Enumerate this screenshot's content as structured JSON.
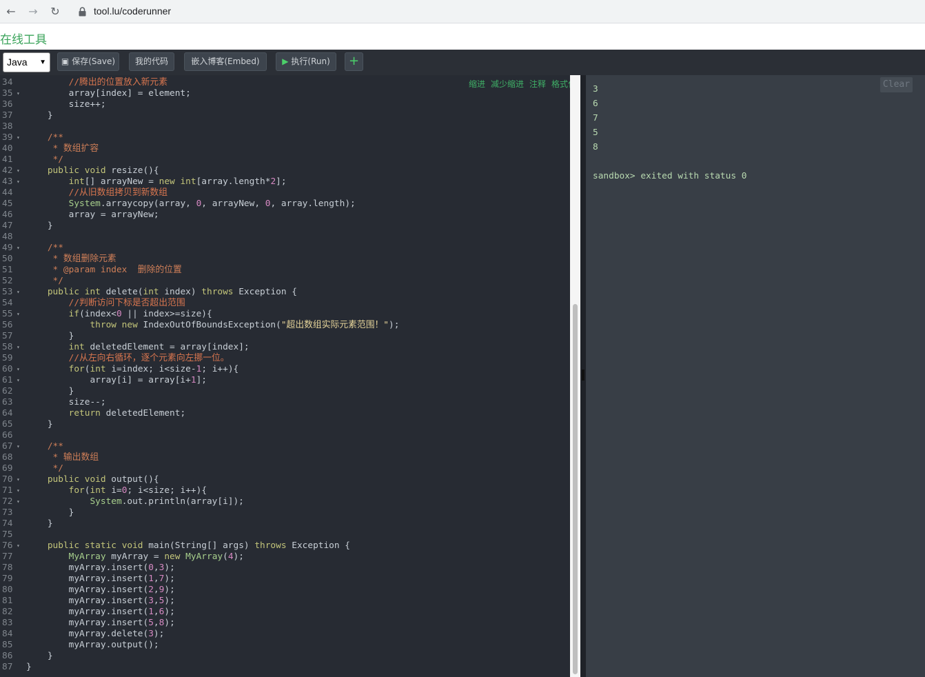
{
  "browser": {
    "back_icon": "arrow-left-icon",
    "forward_icon": "arrow-right-icon",
    "reload_icon": "reload-icon",
    "url": "tool.lu/coderunner"
  },
  "site": {
    "title": "在线工具"
  },
  "toolbar": {
    "language": "Java",
    "save_label": "保存(Save)",
    "mycode_label": "我的代码",
    "embed_label": "嵌入博客(Embed)",
    "run_label": "执行(Run)",
    "add_label": "+"
  },
  "editor": {
    "actions": [
      "缩进",
      "减少缩进",
      "注释",
      "格式化"
    ],
    "lines": [
      {
        "n": "34",
        "fold": "",
        "code": [
          [
            "        ",
            "id"
          ],
          [
            "//腾出的位置放入新元素",
            "cm"
          ]
        ]
      },
      {
        "n": "35",
        "fold": "▾",
        "code": [
          [
            "        array[index] = element;",
            "id"
          ]
        ]
      },
      {
        "n": "36",
        "fold": "",
        "code": [
          [
            "        size++;",
            "id"
          ]
        ]
      },
      {
        "n": "37",
        "fold": "",
        "code": [
          [
            "    }",
            "id"
          ]
        ]
      },
      {
        "n": "38",
        "fold": "",
        "code": []
      },
      {
        "n": "39",
        "fold": "▾",
        "code": [
          [
            "    /**",
            "doc"
          ]
        ]
      },
      {
        "n": "40",
        "fold": "",
        "code": [
          [
            "     * 数组扩容",
            "doc"
          ]
        ]
      },
      {
        "n": "41",
        "fold": "",
        "code": [
          [
            "     */",
            "doc"
          ]
        ]
      },
      {
        "n": "42",
        "fold": "▾",
        "code": [
          [
            "    ",
            "id"
          ],
          [
            "public void",
            "kw"
          ],
          [
            " resize(){",
            "id"
          ]
        ]
      },
      {
        "n": "43",
        "fold": "▾",
        "code": [
          [
            "        ",
            "id"
          ],
          [
            "int",
            "kw"
          ],
          [
            "[] arrayNew = ",
            "id"
          ],
          [
            "new int",
            "kw"
          ],
          [
            "[array.length*",
            "id"
          ],
          [
            "2",
            "num"
          ],
          [
            "];",
            "id"
          ]
        ]
      },
      {
        "n": "44",
        "fold": "",
        "code": [
          [
            "        ",
            "id"
          ],
          [
            "//从旧数组拷贝到新数组",
            "cm"
          ]
        ]
      },
      {
        "n": "45",
        "fold": "",
        "code": [
          [
            "        ",
            "id"
          ],
          [
            "System",
            "fn"
          ],
          [
            ".arraycopy(array, ",
            "id"
          ],
          [
            "0",
            "num"
          ],
          [
            ", arrayNew, ",
            "id"
          ],
          [
            "0",
            "num"
          ],
          [
            ", array.length);",
            "id"
          ]
        ]
      },
      {
        "n": "46",
        "fold": "",
        "code": [
          [
            "        array = arrayNew;",
            "id"
          ]
        ]
      },
      {
        "n": "47",
        "fold": "",
        "code": [
          [
            "    }",
            "id"
          ]
        ]
      },
      {
        "n": "48",
        "fold": "",
        "code": []
      },
      {
        "n": "49",
        "fold": "▾",
        "code": [
          [
            "    /**",
            "doc"
          ]
        ]
      },
      {
        "n": "50",
        "fold": "",
        "code": [
          [
            "     * 数组删除元素",
            "doc"
          ]
        ]
      },
      {
        "n": "51",
        "fold": "",
        "code": [
          [
            "     * @param index  删除的位置",
            "doc"
          ]
        ]
      },
      {
        "n": "52",
        "fold": "",
        "code": [
          [
            "     */",
            "doc"
          ]
        ]
      },
      {
        "n": "53",
        "fold": "▾",
        "code": [
          [
            "    ",
            "id"
          ],
          [
            "public int",
            "kw"
          ],
          [
            " delete(",
            "id"
          ],
          [
            "int",
            "kw"
          ],
          [
            " index) ",
            "id"
          ],
          [
            "throws",
            "kw"
          ],
          [
            " Exception {",
            "id"
          ]
        ]
      },
      {
        "n": "54",
        "fold": "",
        "code": [
          [
            "        ",
            "id"
          ],
          [
            "//判断访问下标是否超出范围",
            "cm"
          ]
        ]
      },
      {
        "n": "55",
        "fold": "▾",
        "code": [
          [
            "        ",
            "id"
          ],
          [
            "if",
            "kw"
          ],
          [
            "(index<",
            "id"
          ],
          [
            "0",
            "num"
          ],
          [
            " || index>=size){",
            "id"
          ]
        ]
      },
      {
        "n": "56",
        "fold": "",
        "code": [
          [
            "            ",
            "id"
          ],
          [
            "throw new",
            "kw"
          ],
          [
            " IndexOutOfBoundsException(",
            "id"
          ],
          [
            "\"超出数组实际元素范围！\"",
            "str"
          ],
          [
            ");",
            "id"
          ]
        ]
      },
      {
        "n": "57",
        "fold": "",
        "code": [
          [
            "        }",
            "id"
          ]
        ]
      },
      {
        "n": "58",
        "fold": "▾",
        "code": [
          [
            "        ",
            "id"
          ],
          [
            "int",
            "kw"
          ],
          [
            " deletedElement = array[index];",
            "id"
          ]
        ]
      },
      {
        "n": "59",
        "fold": "",
        "code": [
          [
            "        ",
            "id"
          ],
          [
            "//从左向右循环，逐个元素向左挪一位。",
            "cm"
          ]
        ]
      },
      {
        "n": "60",
        "fold": "▾",
        "code": [
          [
            "        ",
            "id"
          ],
          [
            "for",
            "kw"
          ],
          [
            "(",
            "id"
          ],
          [
            "int",
            "kw"
          ],
          [
            " i=index; i<size-",
            "id"
          ],
          [
            "1",
            "num"
          ],
          [
            "; i++){",
            "id"
          ]
        ]
      },
      {
        "n": "61",
        "fold": "▾",
        "code": [
          [
            "            array[i] = array[i+",
            "id"
          ],
          [
            "1",
            "num"
          ],
          [
            "];",
            "id"
          ]
        ]
      },
      {
        "n": "62",
        "fold": "",
        "code": [
          [
            "        }",
            "id"
          ]
        ]
      },
      {
        "n": "63",
        "fold": "",
        "code": [
          [
            "        size--;",
            "id"
          ]
        ]
      },
      {
        "n": "64",
        "fold": "",
        "code": [
          [
            "        ",
            "id"
          ],
          [
            "return",
            "kw"
          ],
          [
            " deletedElement;",
            "id"
          ]
        ]
      },
      {
        "n": "65",
        "fold": "",
        "code": [
          [
            "    }",
            "id"
          ]
        ]
      },
      {
        "n": "66",
        "fold": "",
        "code": []
      },
      {
        "n": "67",
        "fold": "▾",
        "code": [
          [
            "    /**",
            "doc"
          ]
        ]
      },
      {
        "n": "68",
        "fold": "",
        "code": [
          [
            "     * 输出数组",
            "doc"
          ]
        ]
      },
      {
        "n": "69",
        "fold": "",
        "code": [
          [
            "     */",
            "doc"
          ]
        ]
      },
      {
        "n": "70",
        "fold": "▾",
        "code": [
          [
            "    ",
            "id"
          ],
          [
            "public void",
            "kw"
          ],
          [
            " output(){",
            "id"
          ]
        ]
      },
      {
        "n": "71",
        "fold": "▾",
        "code": [
          [
            "        ",
            "id"
          ],
          [
            "for",
            "kw"
          ],
          [
            "(",
            "id"
          ],
          [
            "int",
            "kw"
          ],
          [
            " i=",
            "id"
          ],
          [
            "0",
            "num"
          ],
          [
            "; i<size; i++){",
            "id"
          ]
        ]
      },
      {
        "n": "72",
        "fold": "▾",
        "code": [
          [
            "            ",
            "id"
          ],
          [
            "System",
            "fn"
          ],
          [
            ".out.println(array[i]);",
            "id"
          ]
        ]
      },
      {
        "n": "73",
        "fold": "",
        "code": [
          [
            "        }",
            "id"
          ]
        ]
      },
      {
        "n": "74",
        "fold": "",
        "code": [
          [
            "    }",
            "id"
          ]
        ]
      },
      {
        "n": "75",
        "fold": "",
        "code": []
      },
      {
        "n": "76",
        "fold": "▾",
        "code": [
          [
            "    ",
            "id"
          ],
          [
            "public static void",
            "kw"
          ],
          [
            " main(String[] args) ",
            "id"
          ],
          [
            "throws",
            "kw"
          ],
          [
            " Exception {",
            "id"
          ]
        ]
      },
      {
        "n": "77",
        "fold": "",
        "code": [
          [
            "        ",
            "id"
          ],
          [
            "MyArray",
            "fn"
          ],
          [
            " myArray = ",
            "id"
          ],
          [
            "new",
            "kw"
          ],
          [
            " ",
            "id"
          ],
          [
            "MyArray",
            "fn"
          ],
          [
            "(",
            "id"
          ],
          [
            "4",
            "num"
          ],
          [
            ");",
            "id"
          ]
        ]
      },
      {
        "n": "78",
        "fold": "",
        "code": [
          [
            "        myArray.insert(",
            "id"
          ],
          [
            "0",
            "num"
          ],
          [
            ",",
            "id"
          ],
          [
            "3",
            "num"
          ],
          [
            ");",
            "id"
          ]
        ]
      },
      {
        "n": "79",
        "fold": "",
        "code": [
          [
            "        myArray.insert(",
            "id"
          ],
          [
            "1",
            "num"
          ],
          [
            ",",
            "id"
          ],
          [
            "7",
            "num"
          ],
          [
            ");",
            "id"
          ]
        ]
      },
      {
        "n": "80",
        "fold": "",
        "code": [
          [
            "        myArray.insert(",
            "id"
          ],
          [
            "2",
            "num"
          ],
          [
            ",",
            "id"
          ],
          [
            "9",
            "num"
          ],
          [
            ");",
            "id"
          ]
        ]
      },
      {
        "n": "81",
        "fold": "",
        "code": [
          [
            "        myArray.insert(",
            "id"
          ],
          [
            "3",
            "num"
          ],
          [
            ",",
            "id"
          ],
          [
            "5",
            "num"
          ],
          [
            ");",
            "id"
          ]
        ]
      },
      {
        "n": "82",
        "fold": "",
        "code": [
          [
            "        myArray.insert(",
            "id"
          ],
          [
            "1",
            "num"
          ],
          [
            ",",
            "id"
          ],
          [
            "6",
            "num"
          ],
          [
            ");",
            "id"
          ]
        ]
      },
      {
        "n": "83",
        "fold": "",
        "code": [
          [
            "        myArray.insert(",
            "id"
          ],
          [
            "5",
            "num"
          ],
          [
            ",",
            "id"
          ],
          [
            "8",
            "num"
          ],
          [
            ");",
            "id"
          ]
        ]
      },
      {
        "n": "84",
        "fold": "",
        "code": [
          [
            "        myArray.delete(",
            "id"
          ],
          [
            "3",
            "num"
          ],
          [
            ");",
            "id"
          ]
        ]
      },
      {
        "n": "85",
        "fold": "",
        "code": [
          [
            "        myArray.output();",
            "id"
          ]
        ]
      },
      {
        "n": "86",
        "fold": "",
        "code": [
          [
            "    }",
            "id"
          ]
        ]
      },
      {
        "n": "87",
        "fold": "",
        "code": [
          [
            "}",
            "id"
          ]
        ]
      }
    ]
  },
  "output": {
    "clear_label": "Clear",
    "lines": [
      "3",
      "6",
      "7",
      "5",
      "8",
      "",
      "sandbox> exited with status 0"
    ]
  }
}
